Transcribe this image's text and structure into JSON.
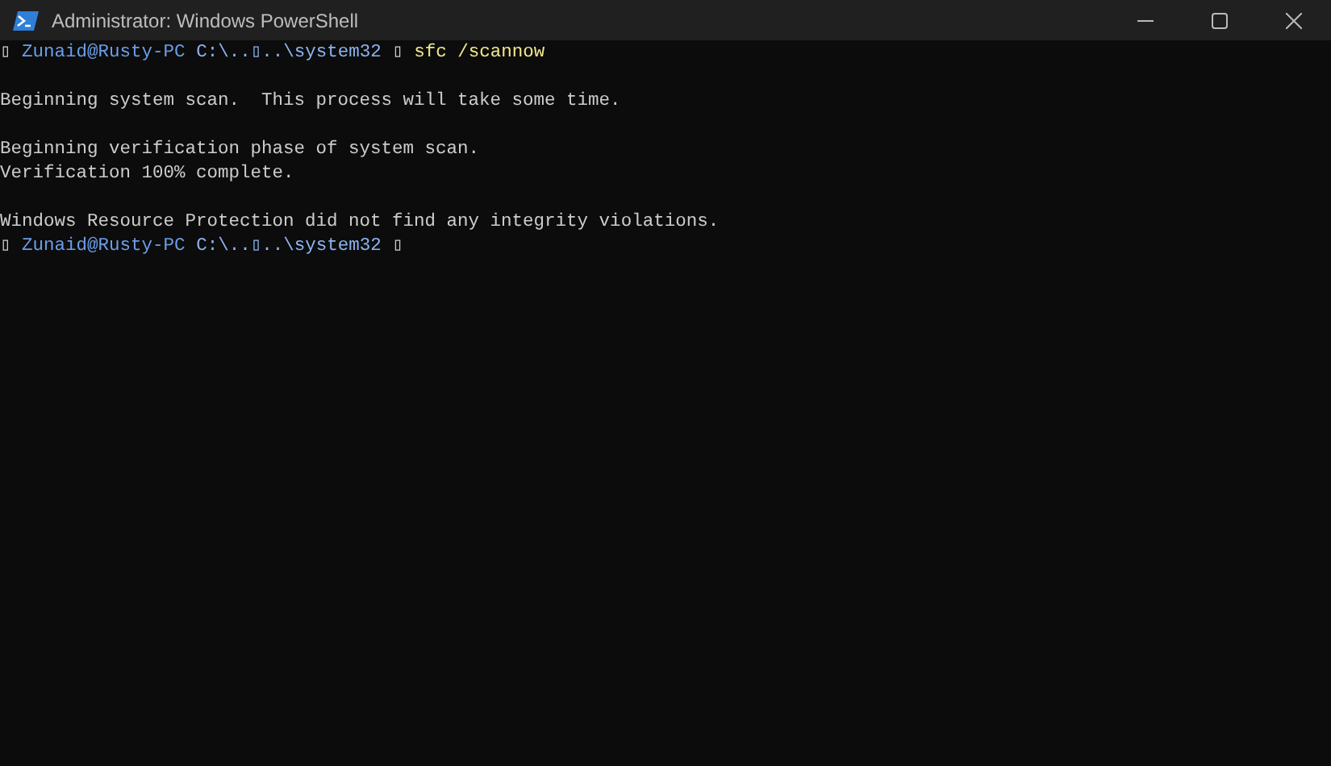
{
  "window": {
    "title": "Administrator: Windows PowerShell"
  },
  "lines": [
    {
      "kind": "prompt",
      "glyph": "▯",
      "user": "Zunaid@Rusty-PC",
      "path": "C:\\..▯..\\system32",
      "separator": "▯",
      "command": "sfc /scannow"
    },
    {
      "kind": "blank"
    },
    {
      "kind": "output",
      "text": "Beginning system scan.  This process will take some time."
    },
    {
      "kind": "blank"
    },
    {
      "kind": "output",
      "text": "Beginning verification phase of system scan."
    },
    {
      "kind": "output",
      "text": "Verification 100% complete."
    },
    {
      "kind": "blank"
    },
    {
      "kind": "output",
      "text": "Windows Resource Protection did not find any integrity violations."
    },
    {
      "kind": "prompt",
      "glyph": "▯",
      "user": "Zunaid@Rusty-PC",
      "path": "C:\\..▯..\\system32",
      "separator": "▯"
    }
  ]
}
